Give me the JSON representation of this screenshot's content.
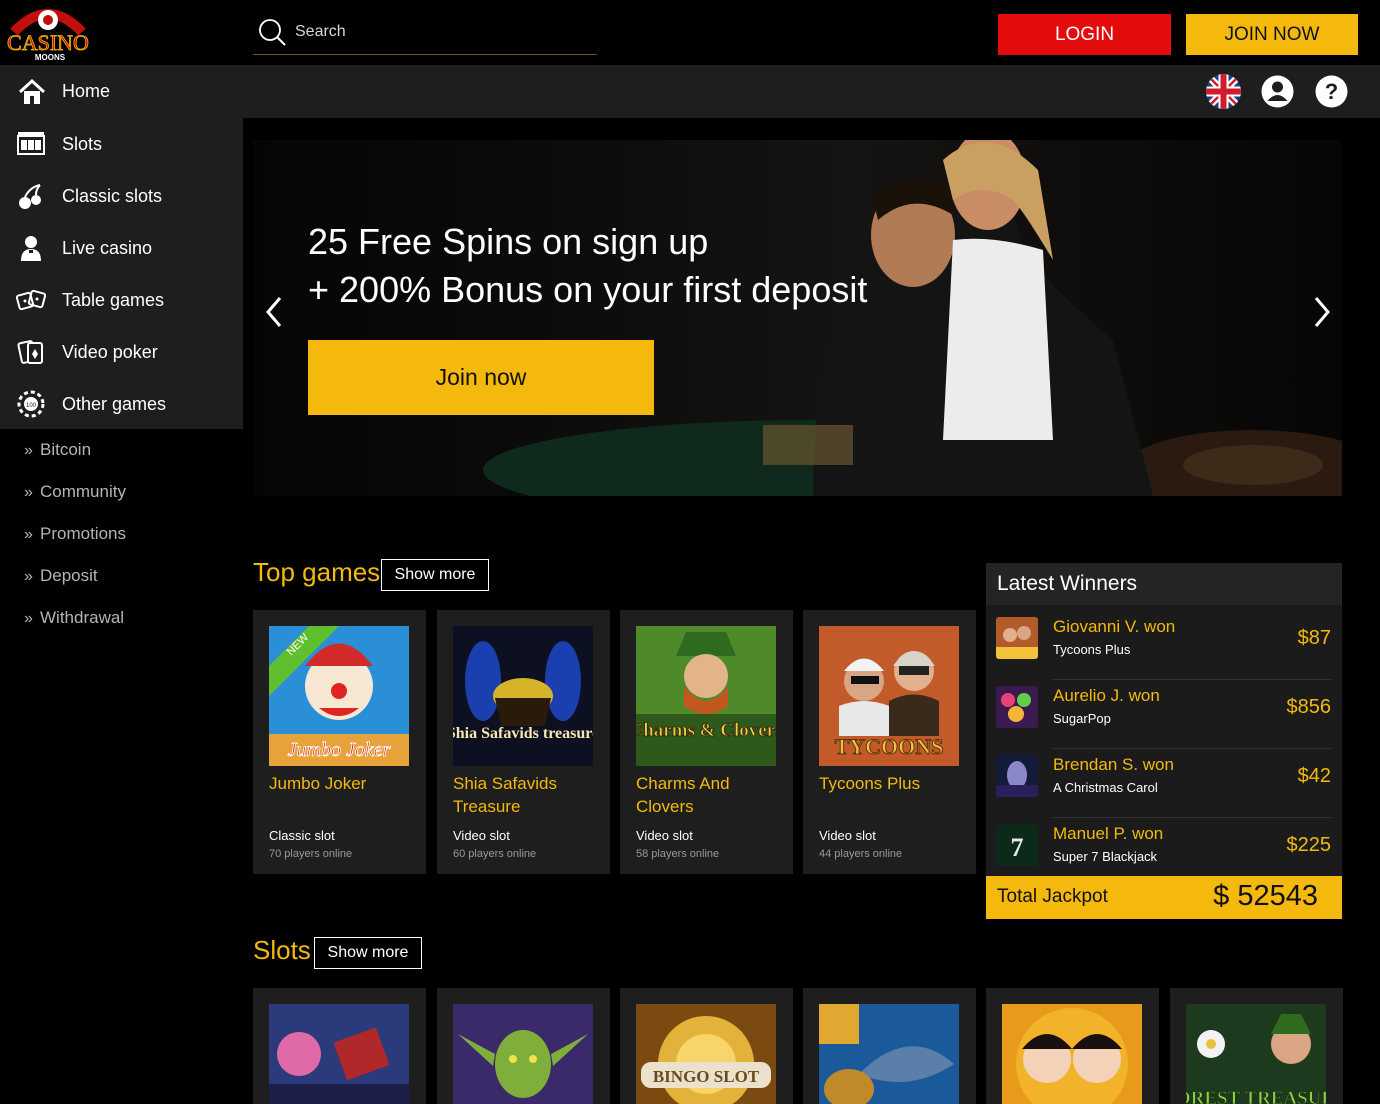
{
  "brand": {
    "logo_top": "CASINO",
    "logo_bottom": "MOONS"
  },
  "search": {
    "placeholder": "Search"
  },
  "header": {
    "login_label": "LOGIN",
    "join_label": "JOIN NOW"
  },
  "nav": {
    "home_label": "Home"
  },
  "sidebar": {
    "items": [
      {
        "label": "Slots",
        "icon": "slot-machine-icon"
      },
      {
        "label": "Classic slots",
        "icon": "cherry-icon"
      },
      {
        "label": "Live casino",
        "icon": "dealer-icon"
      },
      {
        "label": "Table games",
        "icon": "dice-icon"
      },
      {
        "label": "Video poker",
        "icon": "cards-icon"
      },
      {
        "label": "Other games",
        "icon": "chip-icon"
      }
    ],
    "links": [
      "Bitcoin",
      "Community",
      "Promotions",
      "Deposit",
      "Withdrawal"
    ]
  },
  "banner": {
    "line1": "25 Free Spins on sign up",
    "line2": "+ 200% Bonus on your first deposit",
    "button_label": "Join now"
  },
  "top_games": {
    "title": "Top games",
    "show_more": "Show more",
    "cards": [
      {
        "name": "Jumbo Joker",
        "badge": "NEW",
        "type": "Classic slot",
        "players": "70 players online",
        "thumb_title": "Jumbo Joker"
      },
      {
        "name": "Shia Safavids Treasure",
        "type": "Video slot",
        "players": "60 players online",
        "thumb_title": "Shia Safavids treasure"
      },
      {
        "name": "Charms And Clovers",
        "type": "Video slot",
        "players": "58 players online",
        "thumb_title": "Charms & Clovers"
      },
      {
        "name": "Tycoons Plus",
        "type": "Video slot",
        "players": "44 players online",
        "thumb_title": "TYCOONS"
      }
    ]
  },
  "winners": {
    "title": "Latest Winners",
    "rows": [
      {
        "name": "Giovanni V. won",
        "game": "Tycoons Plus",
        "amount": "$87"
      },
      {
        "name": "Aurelio J. won",
        "game": "SugarPop",
        "amount": "$856"
      },
      {
        "name": "Brendan S. won",
        "game": "A Christmas Carol",
        "amount": "$42"
      },
      {
        "name": "Manuel P. won",
        "game": "Super 7 Blackjack",
        "amount": "$225"
      }
    ],
    "jackpot_label": "Total Jackpot",
    "jackpot_value": "$ 52543"
  },
  "slots": {
    "title": "Slots",
    "show_more": "Show more",
    "thumb_texts": [
      "",
      "",
      "BINGO SLOT",
      "",
      "",
      "FOREST TREASURE"
    ]
  },
  "colors": {
    "accent": "#f4b90c",
    "login": "#e30b0b",
    "panel": "#1e1e1e"
  }
}
